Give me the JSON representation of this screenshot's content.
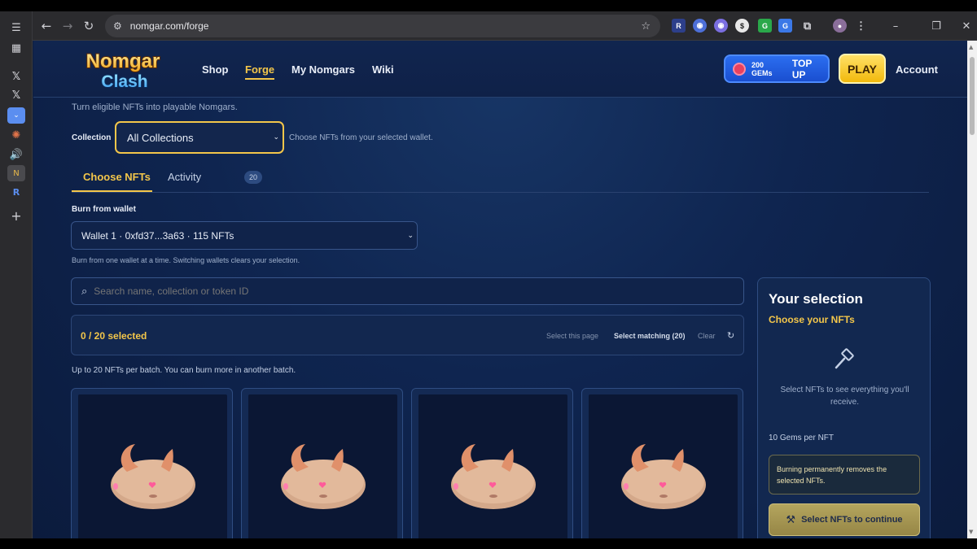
{
  "browser": {
    "url": "nomgar.com/forge",
    "rail_icons": [
      "tab-list-icon",
      "apps-grid-icon",
      "x-icon",
      "x-icon",
      "chevron-down-icon",
      "sparkle-icon",
      "speaker-icon",
      "nomgar-icon",
      "blue-square-icon",
      "plus-icon"
    ]
  },
  "site": {
    "logo_top": "Nomgar",
    "logo_bottom": "Clash",
    "nav": {
      "shop": "Shop",
      "forge": "Forge",
      "my_nomgars": "My Nomgars",
      "wiki": "Wiki"
    },
    "gems_count": "200 GEMs",
    "top_up": "TOP UP",
    "play": "PLAY",
    "account": "Account"
  },
  "forge": {
    "subtitle": "Turn eligible NFTs into playable Nomgars.",
    "collection_label": "Collection",
    "collection_value": "All Collections",
    "collection_hint": "Choose NFTs from your selected wallet.",
    "tabs": {
      "choose": "Choose NFTs",
      "activity": "Activity",
      "activity_count": "20"
    },
    "burn_label": "Burn from wallet",
    "wallet_value": "Wallet 1 · 0xfd37...3a63 · 115 NFTs",
    "wallet_hint": "Burn from one wallet at a time. Switching wallets clears your selection.",
    "search_placeholder": "Search name, collection or token ID",
    "selected": "0 / 20 selected",
    "select_page": "Select this page",
    "select_matching": "Select matching (20)",
    "clear": "Clear",
    "per_batch": "Up to 20 NFTs per batch. You can burn more in another batch."
  },
  "panel": {
    "title": "Your selection",
    "subtitle": "Choose your NFTs",
    "empty": "Select NFTs to see everything you'll receive.",
    "rate": "10 Gems per NFT",
    "warning": "Burning permanently removes the selected NFTs.",
    "button": "Select NFTs to continue"
  },
  "colors": {
    "accent": "#f3c64a",
    "page_bg": "#0f2550",
    "gems": "#2b6ef0",
    "play": "#f2b90c"
  }
}
